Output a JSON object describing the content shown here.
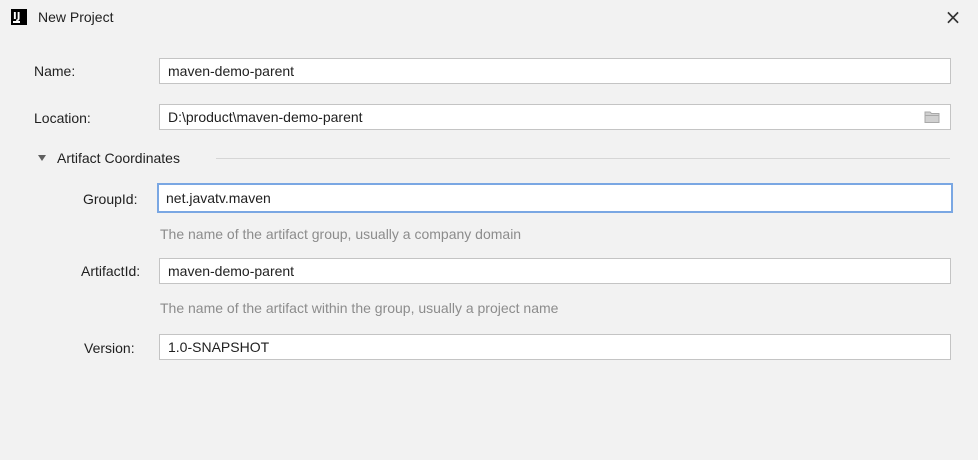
{
  "window": {
    "title": "New Project",
    "logo_text": "IJ",
    "close_glyph": "×"
  },
  "form": {
    "name": {
      "label": "Name:",
      "value": "maven-demo-parent"
    },
    "location": {
      "label": "Location:",
      "value": "D:\\product\\maven-demo-parent",
      "icon": "folder-icon"
    },
    "artifact_section": {
      "title": "Artifact Coordinates",
      "expanded": true,
      "groupid": {
        "label": "GroupId:",
        "value": "net.javatv.maven",
        "hint": "The name of the artifact group, usually a company domain"
      },
      "artifactid": {
        "label": "ArtifactId:",
        "value": "maven-demo-parent",
        "hint": "The name of the artifact within the group, usually a project name"
      },
      "version": {
        "label": "Version:",
        "value": "1.0-SNAPSHOT"
      }
    }
  },
  "colors": {
    "background": "#f2f2f2",
    "field_border": "#c4c4c4",
    "focus_border": "#7aa7e3",
    "hint_text": "#8c8c8c"
  }
}
